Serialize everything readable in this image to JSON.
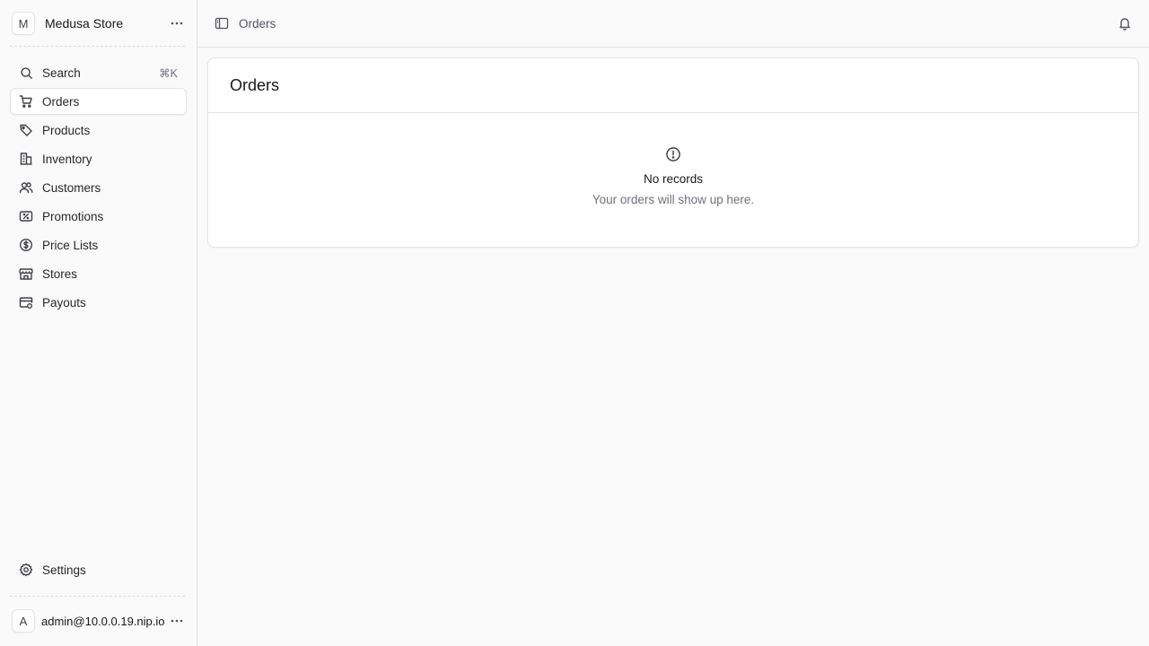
{
  "store": {
    "avatar_letter": "M",
    "name": "Medusa Store",
    "menu_icon": "more-horizontal-icon"
  },
  "nav": {
    "search": {
      "label": "Search",
      "shortcut": "⌘K",
      "icon": "search-icon"
    },
    "items": [
      {
        "label": "Orders",
        "icon": "cart-icon",
        "active": true
      },
      {
        "label": "Products",
        "icon": "tag-icon",
        "active": false
      },
      {
        "label": "Inventory",
        "icon": "buildings-icon",
        "active": false
      },
      {
        "label": "Customers",
        "icon": "users-icon",
        "active": false
      },
      {
        "label": "Promotions",
        "icon": "receipt-percent-icon",
        "active": false
      },
      {
        "label": "Price Lists",
        "icon": "currency-dollar-icon",
        "active": false
      },
      {
        "label": "Stores",
        "icon": "building-storefront-icon",
        "active": false
      },
      {
        "label": "Payouts",
        "icon": "credit-card-icon",
        "active": false
      }
    ],
    "settings": {
      "label": "Settings",
      "icon": "cog-icon"
    }
  },
  "user": {
    "avatar_letter": "A",
    "email": "admin@10.0.0.19.nip.io"
  },
  "topbar": {
    "breadcrumb": "Orders",
    "sidebar_toggle_icon": "sidebar-left-icon",
    "notification_icon": "bell-icon"
  },
  "page": {
    "title": "Orders",
    "empty_state": {
      "icon": "exclamation-circle-icon",
      "title": "No records",
      "subtitle": "Your orders will show up here."
    }
  },
  "colors": {
    "background": "#fafafa",
    "border": "#e4e4e7",
    "text": "#18181b",
    "muted": "#71717a"
  }
}
